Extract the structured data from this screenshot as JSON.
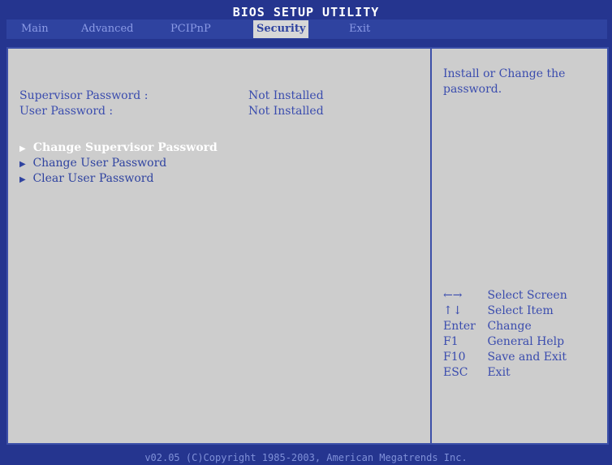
{
  "header": {
    "title": "BIOS SETUP UTILITY"
  },
  "menu": [
    {
      "label": "Main"
    },
    {
      "label": "Advanced"
    },
    {
      "label": "PCIPnP"
    },
    {
      "label": "Security"
    },
    {
      "label": "Exit"
    }
  ],
  "left_panel": {
    "rows": [
      {
        "label": "Supervisor Password :",
        "value": "Not Installed"
      },
      {
        "label": "User Password :",
        "value": "Not Installed"
      }
    ],
    "options": [
      {
        "label": "Change Supervisor Password",
        "arrow": "▶"
      },
      {
        "label": "Change User Password",
        "arrow": "▶"
      },
      {
        "label": "Clear User Password",
        "arrow": "▶"
      }
    ]
  },
  "help": {
    "text": "Install or Change the password."
  },
  "keys": [
    {
      "key": "←→",
      "action": "Select Screen"
    },
    {
      "key": "↑↓",
      "action": "Select Item"
    },
    {
      "key": "Enter",
      "action": "Change"
    },
    {
      "key": "F1",
      "action": "General Help"
    },
    {
      "key": "F10",
      "action": "Save and Exit"
    },
    {
      "key": "ESC",
      "action": "Exit"
    }
  ],
  "footer": {
    "text": "v02.05 (C)Copyright 1985-2003, American Megatrends Inc."
  },
  "colors": {
    "background_blue": "#25358f",
    "panel_gray": "#cdcdcd",
    "text_blue": "#3a4cae",
    "active_menu_bg": "#d7d7d7"
  }
}
